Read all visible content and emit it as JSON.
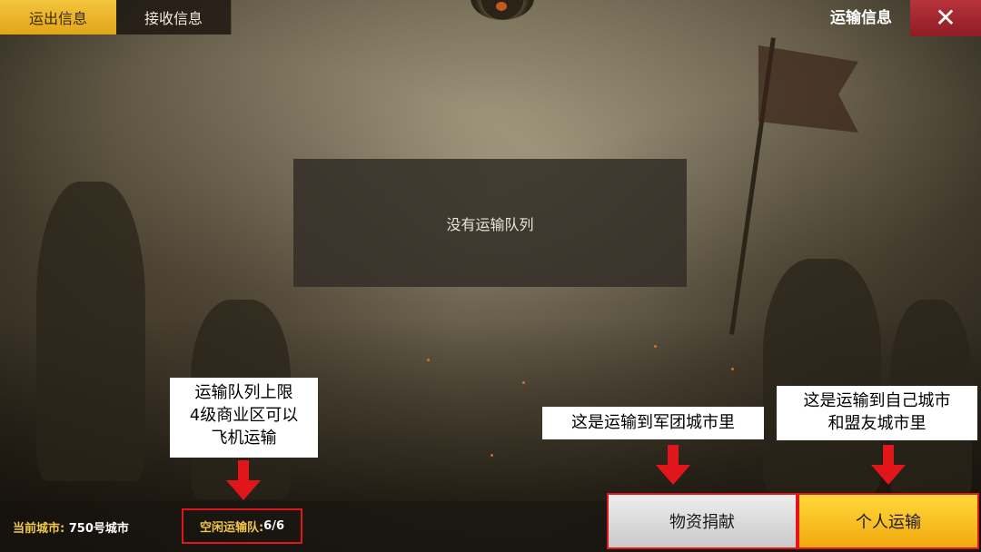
{
  "tabs": {
    "outgoing": "运出信息",
    "incoming": "接收信息"
  },
  "header": {
    "title": "运输信息",
    "close_icon": "close-icon"
  },
  "main": {
    "empty_message": "没有运输队列"
  },
  "footer": {
    "current_city_label": "当前城市:",
    "current_city_value": "750号城市",
    "idle_transport_label": "空闲运输队:",
    "idle_transport_value": "6/6",
    "donate_button": "物资捐献",
    "personal_button": "个人运输"
  },
  "annotations": {
    "note_queue_line1": "运输队列上限",
    "note_queue_line2": "4级商业区可以",
    "note_queue_line3": "飞机运输",
    "note_donate": "这是运输到军团城市里",
    "note_personal_line1": "这是运输到自己城市",
    "note_personal_line2": "和盟友城市里"
  },
  "colors": {
    "active_tab": "#e0a619",
    "close_button": "#a2272e",
    "label_gold": "#f1c74b",
    "annotation_red": "#e0161b",
    "personal_button": "#f2a90f"
  }
}
